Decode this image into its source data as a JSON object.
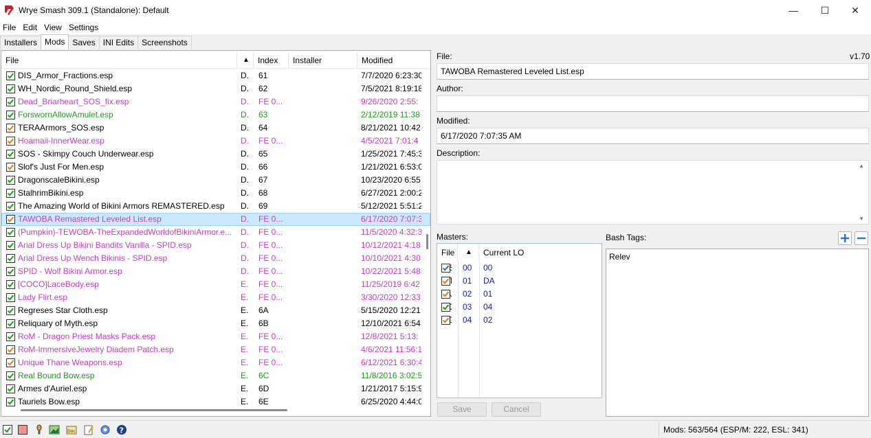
{
  "window": {
    "title": "Wrye Smash 309.1 (Standalone): Default",
    "minimize_glyph": "—",
    "maximize_glyph": "☐",
    "close_glyph": "✕"
  },
  "menu": [
    "File",
    "Edit",
    "View",
    "Settings"
  ],
  "tabs": [
    {
      "label": "Installers",
      "active": false
    },
    {
      "label": "Mods",
      "active": true
    },
    {
      "label": "Saves",
      "active": false
    },
    {
      "label": "INI Edits",
      "active": false
    },
    {
      "label": "Screenshots",
      "active": false
    }
  ],
  "mods_list": {
    "columns": {
      "file": "File",
      "sort": "▲",
      "index": "Index",
      "installer": "Installer",
      "modified": "Modified"
    },
    "rows": [
      {
        "file": "DIS_Armor_Fractions.esp",
        "flag": "D.",
        "index": "61",
        "installer": "",
        "modified": "7/7/2020 6:23:30",
        "color": "black",
        "check": "green"
      },
      {
        "file": "WH_Nordic_Round_Shield.esp",
        "flag": "D.",
        "index": "62",
        "installer": "",
        "modified": "7/5/2021 8:19:18",
        "color": "black",
        "check": "green"
      },
      {
        "file": "Dead_Briarheart_SOS_fix.esp",
        "flag": "D.",
        "index": "FE 0...",
        "installer": "",
        "modified": "9/26/2020 2:55:",
        "color": "magenta",
        "check": "green"
      },
      {
        "file": "ForswornAllowAmulet.esp",
        "flag": "D.",
        "index": "63",
        "installer": "",
        "modified": "2/12/2019 11:38",
        "color": "green",
        "check": "green"
      },
      {
        "file": "TERAArmors_SOS.esp",
        "flag": "D.",
        "index": "64",
        "installer": "",
        "modified": "8/21/2021 10:42",
        "color": "black",
        "check": "orange"
      },
      {
        "file": "Hoamaii-InnerWear.esp",
        "flag": "D.",
        "index": "FE 0...",
        "installer": "",
        "modified": "4/5/2021 7:01:4",
        "color": "magenta",
        "check": "orange"
      },
      {
        "file": "SOS - Skimpy Couch Underwear.esp",
        "flag": "D.",
        "index": "65",
        "installer": "",
        "modified": "1/25/2021 7:45:3",
        "color": "black",
        "check": "green"
      },
      {
        "file": "Slof's Just For Men.esp",
        "flag": "D.",
        "index": "66",
        "installer": "",
        "modified": "1/21/2021 6:53:0",
        "color": "black",
        "check": "orange"
      },
      {
        "file": "DragonscaleBikini.esp",
        "flag": "D.",
        "index": "67",
        "installer": "",
        "modified": "10/23/2020 6:55",
        "color": "black",
        "check": "green"
      },
      {
        "file": "StalhrimBikini.esp",
        "flag": "D.",
        "index": "68",
        "installer": "",
        "modified": "6/27/2021 2:00:2",
        "color": "black",
        "check": "green"
      },
      {
        "file": "The Amazing World of Bikini Armors REMASTERED.esp",
        "flag": "D.",
        "index": "69",
        "installer": "",
        "modified": "5/12/2021 5:51:2",
        "color": "black",
        "check": "green"
      },
      {
        "file": "TAWOBA Remastered Leveled List.esp",
        "flag": "D.",
        "index": "FE 0...",
        "installer": "",
        "modified": "6/17/2020 7:07:3",
        "color": "magenta",
        "check": "orange",
        "selected": true
      },
      {
        "file": "(Pumpkin)-TEWOBA-TheExpandedWorldofBikiniArmor.e...",
        "flag": "D.",
        "index": "FE 0...",
        "installer": "",
        "modified": "11/5/2020 4:32:3",
        "color": "magenta",
        "check": "green"
      },
      {
        "file": "Arial Dress Up Bikini Bandits Vanilla - SPID.esp",
        "flag": "D.",
        "index": "FE 0...",
        "installer": "",
        "modified": "10/12/2021 4:18",
        "color": "magenta",
        "check": "green"
      },
      {
        "file": "Arial Dress Up Wench Bikinis - SPID.esp",
        "flag": "D.",
        "index": "FE 0...",
        "installer": "",
        "modified": "10/10/2021 4:30",
        "color": "magenta",
        "check": "green"
      },
      {
        "file": "SPID - Wolf Bikini Armor.esp",
        "flag": "D.",
        "index": "FE 0...",
        "installer": "",
        "modified": "10/22/2021 5:48",
        "color": "magenta",
        "check": "green"
      },
      {
        "file": "[COCO]LaceBody.esp",
        "flag": "E.",
        "index": "FE 0...",
        "installer": "",
        "modified": "11/25/2019 6:42",
        "color": "magenta",
        "check": "green"
      },
      {
        "file": "Lady Flirt.esp",
        "flag": "E.",
        "index": "FE 0...",
        "installer": "",
        "modified": "3/30/2020 12:33",
        "color": "magenta",
        "check": "green"
      },
      {
        "file": "Regreses Star Cloth.esp",
        "flag": "E.",
        "index": "6A",
        "installer": "",
        "modified": "5/15/2020 12:21",
        "color": "black",
        "check": "green"
      },
      {
        "file": "Reliquary of Myth.esp",
        "flag": "E.",
        "index": "6B",
        "installer": "",
        "modified": "12/10/2021 6:54",
        "color": "black",
        "check": "green"
      },
      {
        "file": "RoM - Dragon Priest Masks Pack.esp",
        "flag": "E.",
        "index": "FE 0...",
        "installer": "",
        "modified": "12/8/2021 5:13:",
        "color": "magenta",
        "check": "green"
      },
      {
        "file": "RoM-ImmersiveJewelry Diadem Patch.esp",
        "flag": "E.",
        "index": "FE 0...",
        "installer": "",
        "modified": "4/6/2021 11:56:1",
        "color": "magenta",
        "check": "orange"
      },
      {
        "file": "Unique Thane Weapons.esp",
        "flag": "E.",
        "index": "FE 0...",
        "installer": "",
        "modified": "6/12/2021 6:30:4",
        "color": "magenta",
        "check": "orange"
      },
      {
        "file": "Real Bound Bow.esp",
        "flag": "E.",
        "index": "6C",
        "installer": "",
        "modified": "11/8/2016 3:02:5",
        "color": "green",
        "check": "green"
      },
      {
        "file": "Armes d'Auriel.esp",
        "flag": "E.",
        "index": "6D",
        "installer": "",
        "modified": "1/21/2017 5:15:9",
        "color": "black",
        "check": "green"
      },
      {
        "file": "Tauriels Bow.esp",
        "flag": "E.",
        "index": "6E",
        "installer": "",
        "modified": "6/25/2020 4:44:0",
        "color": "black",
        "check": "green"
      }
    ]
  },
  "details": {
    "file_label": "File:",
    "version": "v1.70",
    "file_value": "TAWOBA Remastered Leveled List.esp",
    "author_label": "Author:",
    "author_value": "",
    "modified_label": "Modified:",
    "modified_value": "6/17/2020 7:07:35 AM",
    "description_label": "Description:",
    "description_value": "",
    "masters_label": "Masters:",
    "bash_tags_label": "Bash Tags:",
    "bash_tags_value": "Relev",
    "save_label": "Save",
    "cancel_label": "Cancel"
  },
  "masters": {
    "columns": {
      "file": "File",
      "sort": "▲",
      "current_lo": "Current LO"
    },
    "rows": [
      {
        "cut": "S",
        "index": "00",
        "current": "00",
        "check": "blue"
      },
      {
        "cut": "T",
        "index": "01",
        "current": "DA",
        "check": "orange"
      },
      {
        "cut": "U",
        "index": "02",
        "current": "01",
        "check": "orange"
      },
      {
        "cut": "D",
        "index": "03",
        "current": "04",
        "check": "green"
      },
      {
        "cut": "D",
        "index": "04",
        "current": "02",
        "check": "orange"
      }
    ]
  },
  "status": {
    "mods_count": "Mods: 563/564 (ESP/M: 222, ESL: 341)"
  },
  "status_icons": [
    "checkbox-icon",
    "red-square-icon",
    "tools-icon",
    "image-icon",
    "document-icon",
    "doc-icon",
    "notepad-icon",
    "settings-icon",
    "help-icon"
  ]
}
